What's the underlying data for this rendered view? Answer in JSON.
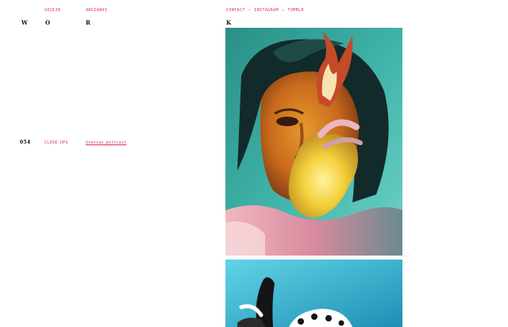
{
  "nav": {
    "name_first": "SOUIZA",
    "name_last": "ARGIANOI",
    "contact": "CONTACT",
    "instagram": "INSTAGRAM",
    "tumblr": "TUMBLR",
    "separator": "—"
  },
  "heading_letters": [
    "W",
    "O",
    "R",
    "K"
  ],
  "projects": [
    {
      "number": "054",
      "category": "CLOSE-UPS",
      "title": "Grenian portrait"
    }
  ],
  "artworks": [
    {
      "icon": "portrait-artwork-image",
      "palette": [
        "#2fa79a",
        "#d8862a",
        "#f4d04a",
        "#1e1e1e",
        "#e6a8b3"
      ]
    },
    {
      "icon": "portrait-artwork-image-2",
      "palette": [
        "#3fc3d8",
        "#1b8fb3",
        "#ffffff",
        "#111111"
      ]
    }
  ],
  "overflow_marker": "..."
}
